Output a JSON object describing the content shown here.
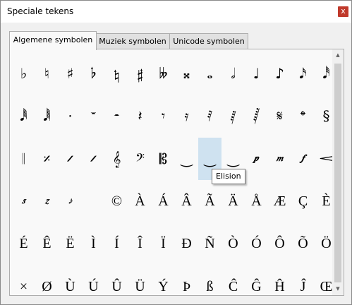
{
  "window": {
    "title": "Speciale tekens",
    "close_label": "x"
  },
  "tabs": [
    {
      "label": "Algemene symbolen",
      "active": true
    },
    {
      "label": "Muziek symbolen",
      "active": false
    },
    {
      "label": "Unicode symbolen",
      "active": false
    }
  ],
  "tooltip": "Elision",
  "selected_symbol": "‿",
  "scrollbar": {
    "up_icon": "triangle-up",
    "down_icon": "triangle-down"
  },
  "rows": [
    [
      "♭",
      "♮",
      "♯",
      "𝄬",
      "𝄮",
      "𝄰",
      "𝄫",
      "𝄪",
      "𝅝",
      "𝅗𝅥",
      "♩",
      "♪",
      "𝅘𝅥𝅯",
      "𝅘𝅥𝅰"
    ],
    [
      "𝅘𝅥𝅱",
      "𝅘𝅥𝅲",
      "·",
      "𝄻",
      "𝄼",
      "𝄽",
      "𝄾",
      "𝄿",
      "𝅀",
      "𝅁",
      "𝅂",
      "𝄋",
      "𝄌",
      "§"
    ],
    [
      "𝄁",
      "𝄎",
      "𝄍",
      "𝄍",
      "𝄞",
      "𝄢",
      "𝄡",
      "‿",
      "‿",
      "‿",
      "𝆏",
      "𝆐",
      "𝆑",
      "𝆒"
    ],
    [
      "𝆍",
      "𝆎",
      "𝆕",
      "",
      "©",
      "À",
      "Á",
      "Â",
      "Ã",
      "Ä",
      "Å",
      "Æ",
      "Ç",
      "È"
    ],
    [
      "É",
      "Ê",
      "Ë",
      "Ì",
      "Í",
      "Î",
      "Ï",
      "Đ",
      "Ñ",
      "Ò",
      "Ó",
      "Ô",
      "Õ",
      "Ö"
    ],
    [
      "×",
      "Ø",
      "Ù",
      "Ú",
      "Û",
      "Ü",
      "Ý",
      "Þ",
      "ß",
      "Ĉ",
      "Ĝ",
      "Ĥ",
      "Ĵ",
      "Œ"
    ]
  ]
}
